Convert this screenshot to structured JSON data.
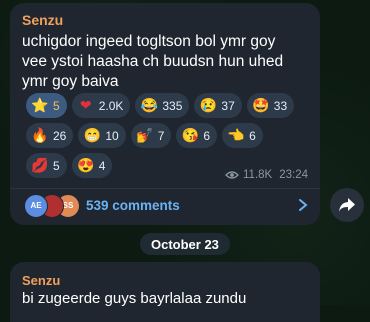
{
  "post": {
    "sender": "Senzu",
    "text_lines": [
      "uchigdor ingeed togltson bol ymr goy",
      "vee ystoi haasha ch buudsn hun uhed",
      "ymr goy baiva"
    ],
    "reactions": [
      {
        "emoji": "⭐",
        "count": "5",
        "active": true
      },
      {
        "emoji": "❤",
        "count": "2.0K"
      },
      {
        "emoji": "😂",
        "count": "335"
      },
      {
        "emoji": "😢",
        "count": "37"
      },
      {
        "emoji": "🤩",
        "count": "33"
      },
      {
        "emoji": "🔥",
        "count": "26"
      },
      {
        "emoji": "😁",
        "count": "10"
      },
      {
        "emoji": "💅",
        "count": "7"
      },
      {
        "emoji": "😘",
        "count": "6"
      },
      {
        "emoji": "👈",
        "count": "6"
      },
      {
        "emoji": "💋",
        "count": "5"
      },
      {
        "emoji": "😍",
        "count": "4"
      }
    ],
    "views": "11.8K",
    "time": "23:24",
    "comments_label": "539 comments",
    "comment_avatars": [
      {
        "initials": "AE",
        "color": "#5b8de0"
      },
      {
        "initials": "",
        "color": "#b03030"
      },
      {
        "initials": "SS",
        "color": "#e08a55"
      }
    ]
  },
  "date_separator": "October 23",
  "next_post": {
    "sender": "Senzu",
    "text": "bi zugeerde guys bayrlalaa zundu"
  }
}
